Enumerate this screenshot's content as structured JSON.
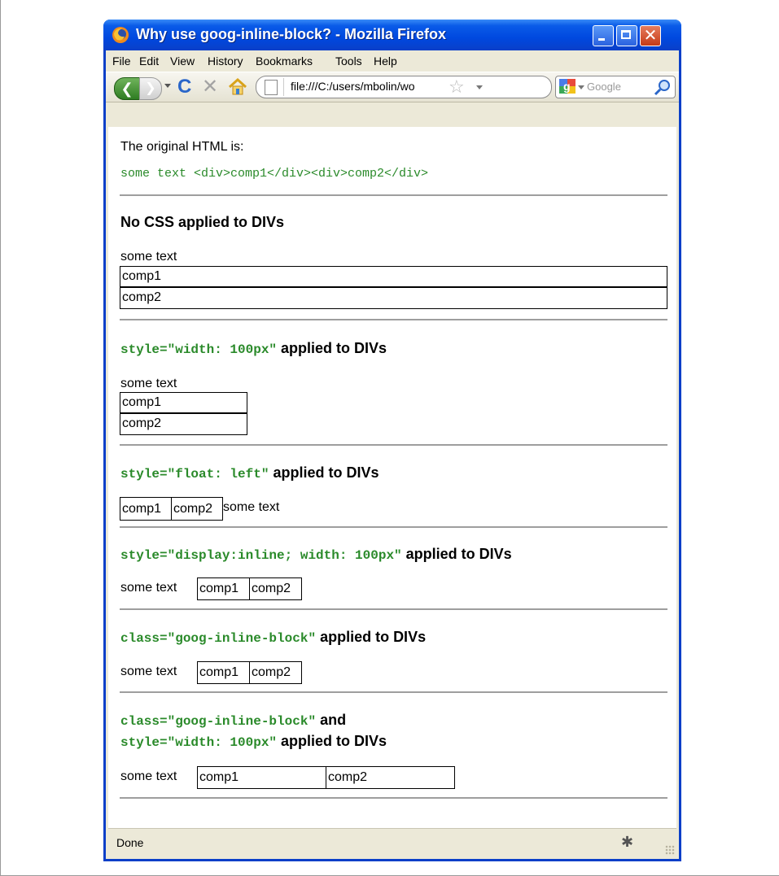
{
  "window": {
    "title": "Why use goog-inline-block? - Mozilla Firefox",
    "close_glyph": "✕"
  },
  "menu": [
    "File",
    "Edit",
    "View",
    "History",
    "Bookmarks",
    "Tools",
    "Help"
  ],
  "nav": {
    "back_glyph": "❮",
    "forward_glyph": "❯",
    "reload_glyph": "C",
    "stop_glyph": "✕",
    "url": "file:///C:/users/mbolin/wo",
    "search_placeholder": "Google"
  },
  "content": {
    "intro": "The original HTML is:",
    "code": "some text <div>comp1</div><div>comp2</div>",
    "sections": [
      {
        "heading": "No CSS applied to DIVs",
        "some_text": "some text",
        "comp1": "comp1",
        "comp2": "comp2"
      },
      {
        "heading_code": "style=\"width: 100px\"",
        "heading_text": "applied to DIVs",
        "some_text": "some text",
        "comp1": "comp1",
        "comp2": "comp2"
      },
      {
        "heading_code": "style=\"float: left\"",
        "heading_text": "applied to DIVs",
        "comp1": "comp1",
        "comp2": "comp2",
        "some_text": "some text"
      },
      {
        "heading_code": "style=\"display:inline; width: 100px\"",
        "heading_text": "applied to DIVs",
        "some_text": "some text",
        "comp1": "comp1",
        "comp2": "comp2"
      },
      {
        "heading_code": "class=\"goog-inline-block\"",
        "heading_text": "applied to DIVs",
        "some_text": "some text",
        "comp1": "comp1",
        "comp2": "comp2"
      },
      {
        "heading_code": "class=\"goog-inline-block\"",
        "heading_and": "and",
        "heading_code2": "style=\"width: 100px\"",
        "heading_text": "applied to DIVs",
        "some_text": "some text",
        "comp1": "comp1",
        "comp2": "comp2"
      }
    ]
  },
  "status": {
    "text": "Done"
  }
}
